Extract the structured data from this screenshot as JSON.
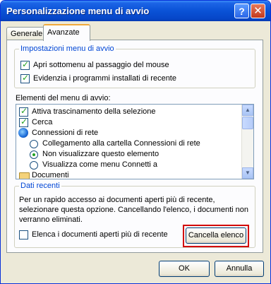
{
  "window": {
    "title": "Personalizzazione menu di avvio",
    "help_glyph": "?",
    "close_glyph": "✕"
  },
  "tabs": [
    {
      "label": "Generale",
      "active": false
    },
    {
      "label": "Avanzate",
      "active": true
    }
  ],
  "start_menu_settings": {
    "title": "Impostazioni menu di avvio",
    "options": [
      {
        "label": "Apri sottomenu al passaggio del mouse",
        "checked": true
      },
      {
        "label": "Evidenzia i programmi installati di recente",
        "checked": true
      }
    ]
  },
  "start_menu_items": {
    "label": "Elementi del menu di avvio:",
    "items": [
      {
        "label": "Attiva trascinamento della selezione"
      },
      {
        "label": "Cerca"
      },
      {
        "label": "Connessioni di rete"
      },
      {
        "label": "Collegamento alla cartella Connessioni di rete"
      },
      {
        "label": "Non visualizzare questo elemento"
      },
      {
        "label": "Visualizza come menu Connetti a"
      },
      {
        "label": "Documenti"
      }
    ],
    "scroll_up_glyph": "▲",
    "scroll_down_glyph": "▼"
  },
  "recent_docs": {
    "title": "Dati recenti",
    "description": "Per un rapido accesso ai documenti aperti più di recente, selezionare questa opzione. Cancellando l'elenco, i documenti non verranno eliminati.",
    "list_label": "Elenca i documenti aperti più di recente",
    "list_checked": false,
    "clear_button": "Cancella elenco"
  },
  "footer": {
    "ok": "OK",
    "cancel": "Annulla"
  },
  "colors": {
    "title_bar": "#0a52d6",
    "group_title": "#0046d5",
    "highlight": "#d20000",
    "check": "#21a121"
  }
}
